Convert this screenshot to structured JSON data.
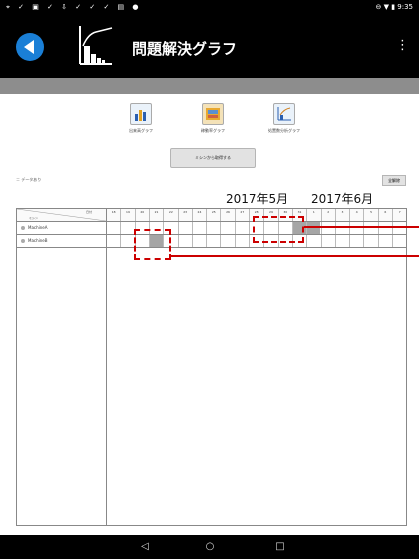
{
  "status_bar": {
    "left_icons": "⌖ ✓ ▣ ✓ ⇩ ✓ ✓ ✓ ▤ ●",
    "right_text": "⊖ ▼ ▮ 9:35"
  },
  "app_bar": {
    "title": "問題解決グラフ",
    "back_icon": "back-arrow-icon",
    "menu_icon": "⋮",
    "accent_color": "#1a7fd6"
  },
  "graph_buttons": [
    {
      "label": "出来高グラフ",
      "icon": "bar-chart-icon"
    },
    {
      "label": "稼動率グラフ",
      "icon": "rate-chart-icon"
    },
    {
      "label": "処置数分析グラフ",
      "icon": "pareto-chart-icon"
    }
  ],
  "get_button_label": "ミシンから取得する",
  "data_label": "＝ データあり",
  "clear_button_label": "全解除",
  "months": [
    "2017年5月",
    "2017年6月"
  ],
  "grid": {
    "corner_top": "日付",
    "corner_bottom": "ミシン",
    "days": [
      "18",
      "19",
      "20",
      "21",
      "22",
      "23",
      "24",
      "25",
      "26",
      "27",
      "28",
      "29",
      "30",
      "31",
      "1",
      "2",
      "3",
      "4",
      "5",
      "6",
      "7"
    ],
    "machines": [
      {
        "name": "MachineA",
        "filled": [
          13,
          14
        ]
      },
      {
        "name": "MachineB",
        "filled": [
          3
        ]
      }
    ]
  },
  "highlight_color": "#cc0000",
  "nav": {
    "back": "◁",
    "home": "○",
    "recent": "□"
  }
}
